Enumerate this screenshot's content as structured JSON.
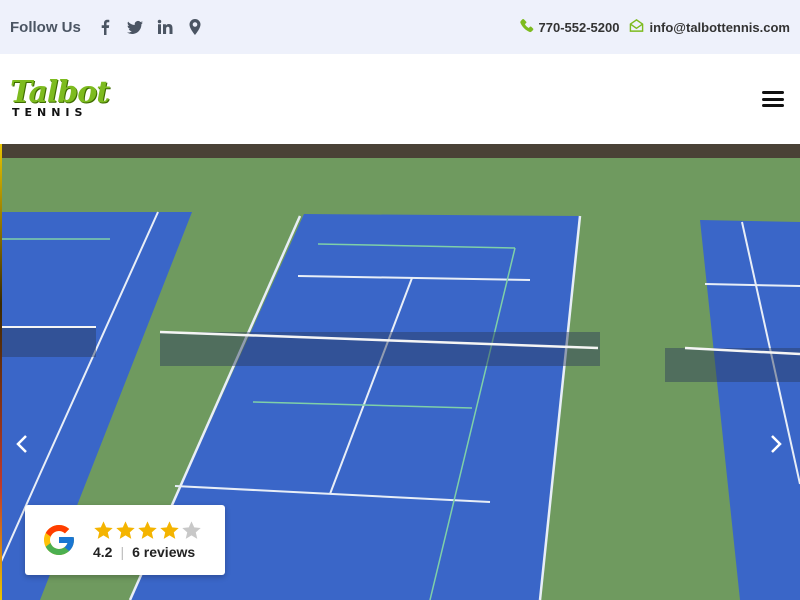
{
  "topbar": {
    "follow_label": "Follow Us",
    "social_icons": [
      "facebook-icon",
      "twitter-icon",
      "linkedin-icon",
      "map-pin-icon"
    ],
    "phone": "770-552-5200",
    "email": "info@talbottennis.com"
  },
  "header": {
    "logo_text": "Talbot",
    "logo_subtext": "TENNIS",
    "menu_icon": "hamburger-menu-icon"
  },
  "review": {
    "rating": "4.2",
    "rating_value": 4.2,
    "rating_max": 5,
    "count_label": "6 reviews"
  },
  "colors": {
    "topbar_bg": "#eef1fb",
    "accent_green": "#7dbb1f",
    "court_blue": "#3a66c8",
    "court_green": "#6f9a5f"
  }
}
